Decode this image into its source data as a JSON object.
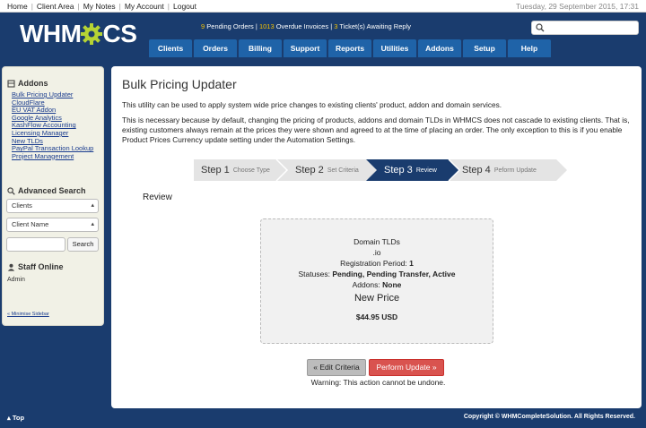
{
  "topbar": {
    "links": [
      "Home",
      "Client Area",
      "My Notes",
      "My Account",
      "Logout"
    ],
    "date": "Tuesday, 29 September 2015, 17:31"
  },
  "header": {
    "logo_text_a": "WHM",
    "logo_text_b": "CS",
    "alerts": {
      "pending_orders_count": "9",
      "pending_orders_label": "Pending Orders",
      "overdue_count": "1013",
      "overdue_label": "Overdue Invoices",
      "tickets_count": "3",
      "tickets_label": "Ticket(s) Awaiting Reply"
    },
    "search_placeholder": ""
  },
  "nav": {
    "items": [
      "Clients",
      "Orders",
      "Billing",
      "Support",
      "Reports",
      "Utilities",
      "Addons",
      "Setup",
      "Help"
    ]
  },
  "sidebar": {
    "addons_title": "Addons",
    "addon_links": [
      "Bulk Pricing Updater",
      "CloudFlare",
      "EU VAT Addon",
      "Google Analytics",
      "KashFlow Accounting",
      "Licensing Manager",
      "New TLDs",
      "PayPal Transaction Lookup",
      "Project Management"
    ],
    "advanced_search_title": "Advanced Search",
    "search_type_selected": "Clients",
    "search_field_selected": "Client Name",
    "search_button": "Search",
    "staff_title": "Staff Online",
    "staff_member": "Admin",
    "minimise": "« Minimise Sidebar"
  },
  "main": {
    "title": "Bulk Pricing Updater",
    "paragraph1": "This utility can be used to apply system wide price changes to existing clients' product, addon and domain services.",
    "paragraph2": "This is necessary because by default, changing the pricing of products, addons and domain TLDs in WHMCS does not cascade to existing clients. That is, existing customers always remain at the prices they were shown and agreed to at the time of placing an order. The only exception to this is if you enable Product Prices Currency update setting under the Automation Settings.",
    "steps": [
      {
        "label": "Step 1",
        "sub": "Choose Type"
      },
      {
        "label": "Step 2",
        "sub": "Set Criteria"
      },
      {
        "label": "Step 3",
        "sub": "Review"
      },
      {
        "label": "Step 4",
        "sub": "Peform Update"
      }
    ],
    "active_step": 3,
    "review_label": "Review",
    "summary": {
      "type": "Domain TLDs",
      "tld": ".io",
      "reg_period_label": "Registration Period:",
      "reg_period_value": "1",
      "statuses_label": "Statuses:",
      "statuses_value": "Pending, Pending Transfer, Active",
      "addons_label": "Addons:",
      "addons_value": "None",
      "new_price_label": "New Price",
      "new_price_value": "$44.95 USD"
    },
    "edit_button": "« Edit Criteria",
    "perform_button": "Perform Update »",
    "warning": "Warning: This action cannot be undone."
  },
  "footer": {
    "top_link": "Top",
    "copyright": "Copyright © WHMCompleteSolution. All Rights Reserved."
  },
  "colors": {
    "header_bg": "#1a3c6e",
    "nav_bg": "#1f63a8",
    "step_active": "#1a3c6e",
    "step_inactive": "#e4e4e4",
    "danger": "#d9534f",
    "logo_gear": "#b5d334"
  }
}
